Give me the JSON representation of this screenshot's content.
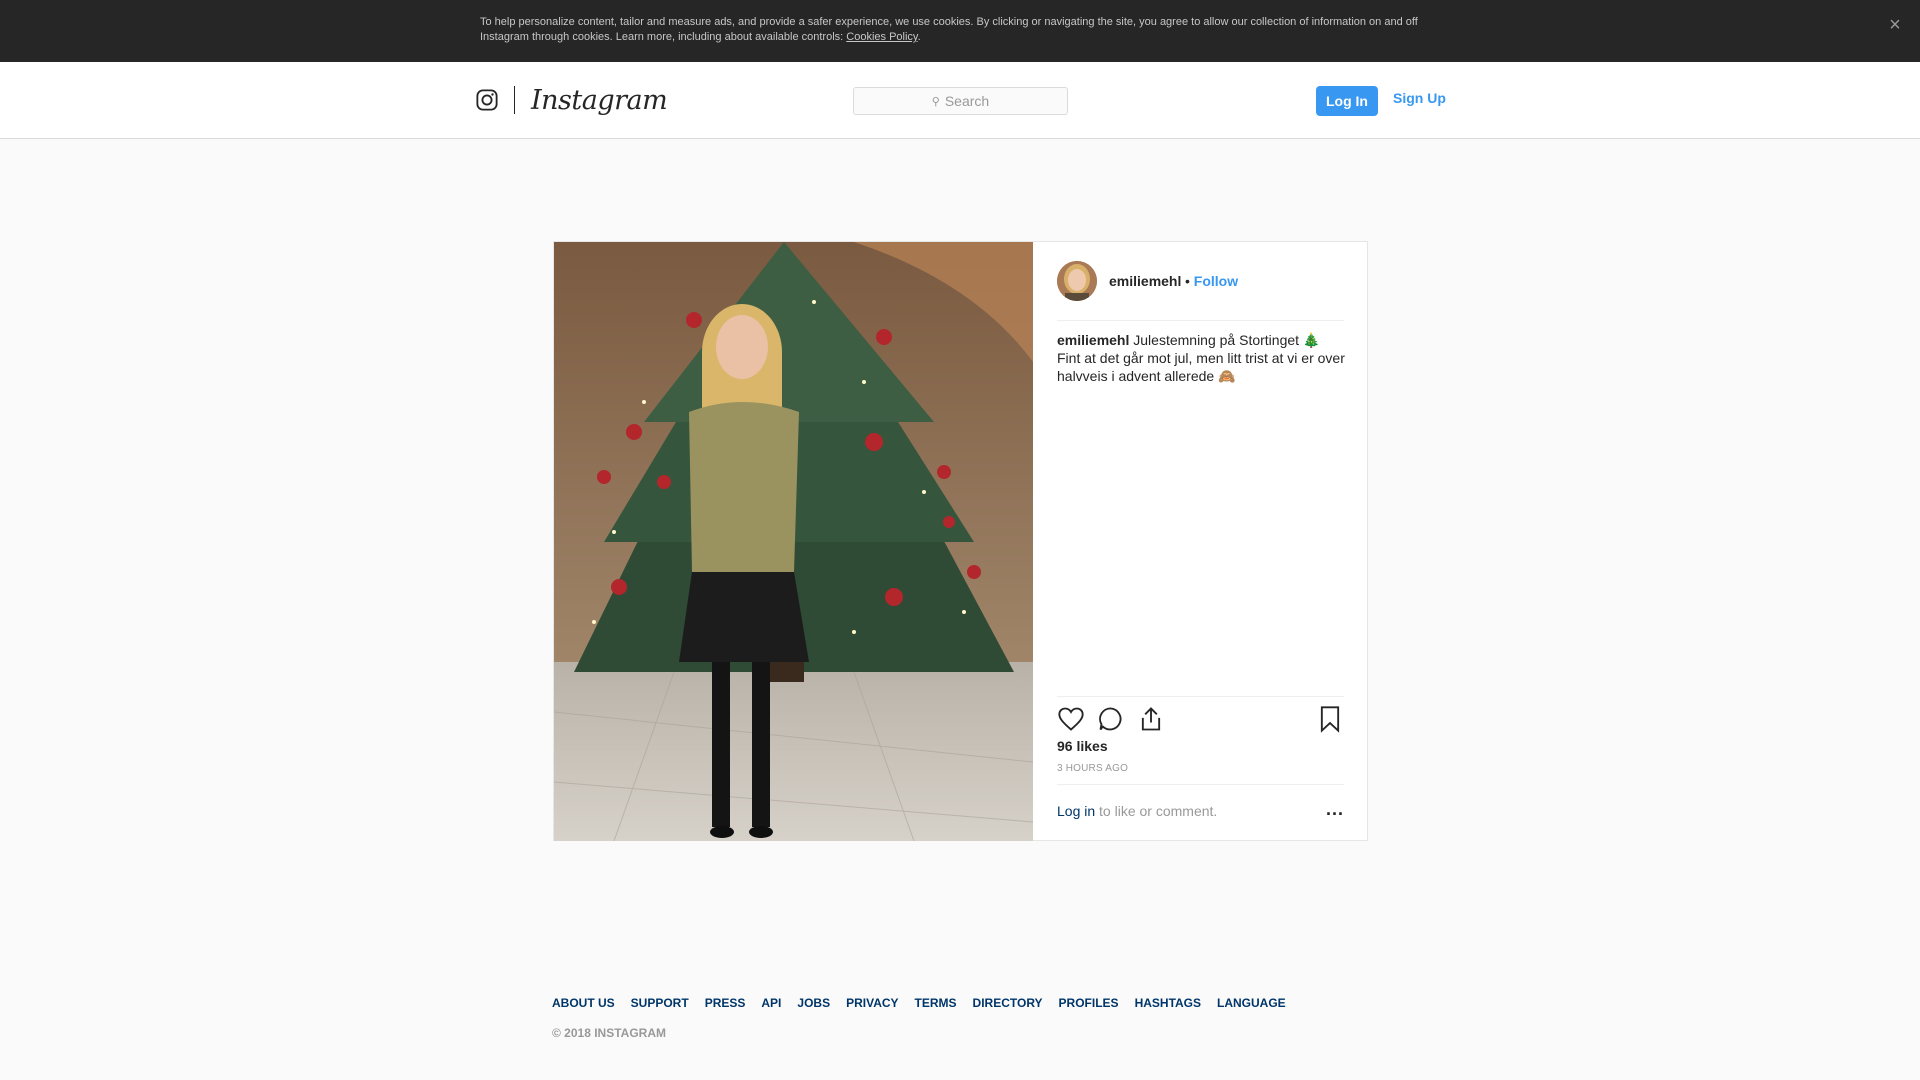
{
  "cookie_banner": {
    "text": "To help personalize content, tailor and measure ads, and provide a safer experience, we use cookies. By clicking or navigating the site, you agree to allow our collection of information on and off Instagram through cookies. Learn more, including about available controls: ",
    "link_label": "Cookies Policy",
    "trailing": ".",
    "close_icon": "close-icon"
  },
  "header": {
    "wordmark": "Instagram",
    "search_placeholder": "Search",
    "login_label": "Log In",
    "signup_label": "Sign Up"
  },
  "post": {
    "username": "emiliemehl",
    "separator": " • ",
    "follow_label": "Follow",
    "caption_user": "emiliemehl",
    "caption_text": " Julestemning på Stortinget 🎄 Fint at det går mot jul, men litt trist at vi er over halvveis i advent allerede 🙈",
    "likes": "96 likes",
    "timestamp": "3 HOURS AGO",
    "comment_login": "Log in",
    "comment_rest": " to like or comment.",
    "more_label": "...",
    "icons": [
      "heart-icon",
      "comment-icon",
      "share-icon",
      "bookmark-icon"
    ]
  },
  "footer": {
    "links": [
      "ABOUT US",
      "SUPPORT",
      "PRESS",
      "API",
      "JOBS",
      "PRIVACY",
      "TERMS",
      "DIRECTORY",
      "PROFILES",
      "HASHTAGS",
      "LANGUAGE"
    ],
    "copyright": "© 2018 INSTAGRAM"
  },
  "colors": {
    "accent": "#3897f0",
    "banner": "#262626",
    "link_dark": "#003569"
  }
}
